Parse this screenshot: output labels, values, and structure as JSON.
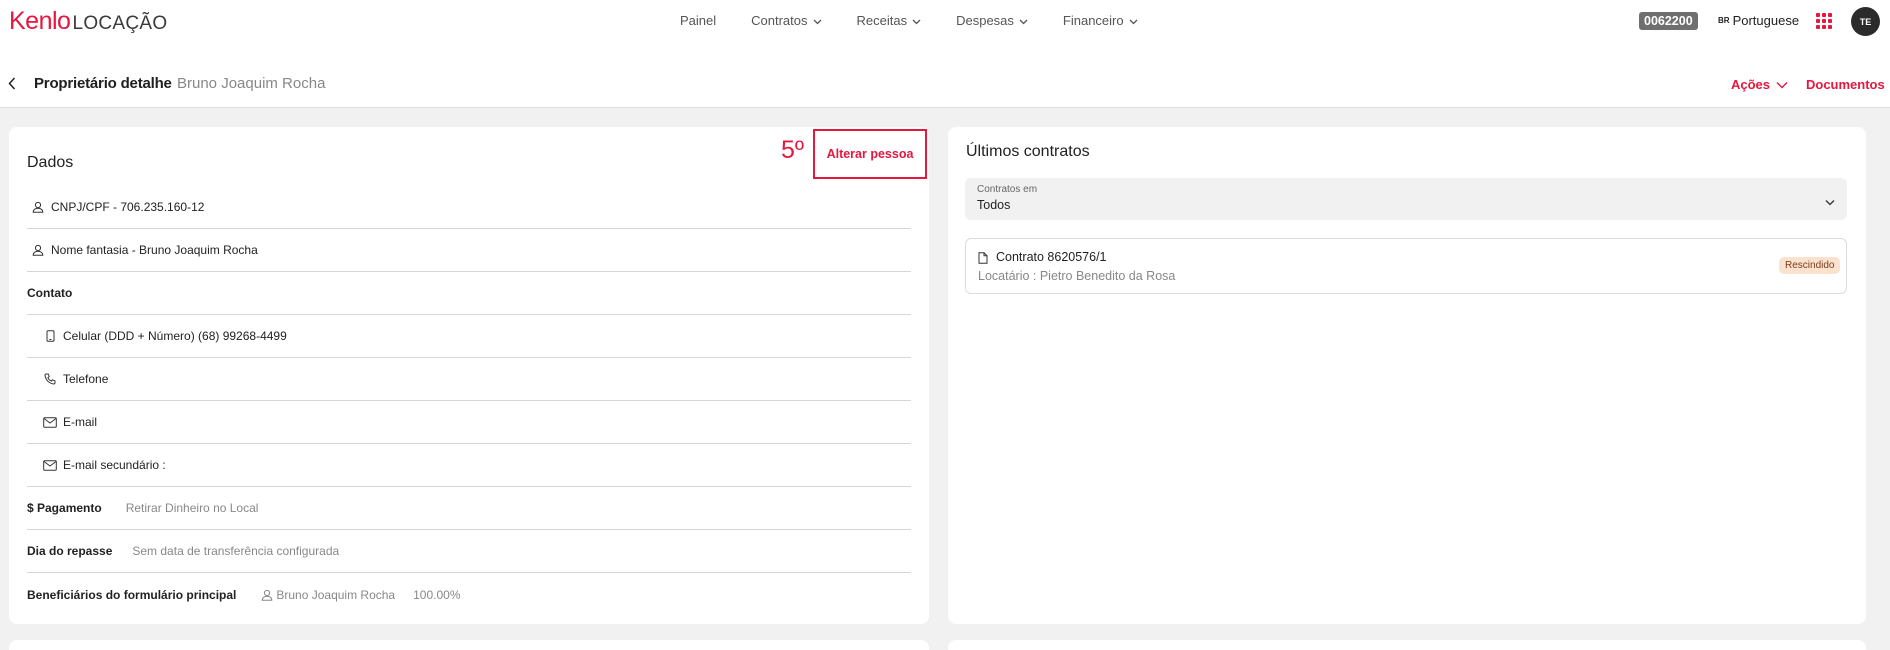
{
  "nav": {
    "logo_brand": "Kenlo",
    "logo_product": "LOCAÇÃO",
    "items": [
      {
        "label": "Painel"
      },
      {
        "label": "Contratos"
      },
      {
        "label": "Receitas"
      },
      {
        "label": "Despesas"
      },
      {
        "label": "Financeiro"
      }
    ],
    "code": "0062200",
    "lang_code": "BR",
    "lang_label": "Portuguese",
    "avatar_initials": "TE"
  },
  "header": {
    "title": "Proprietário detalhe",
    "subtitle": "Bruno Joaquim Rocha",
    "actions_label": "Ações",
    "documents_label": "Documentos"
  },
  "dados": {
    "title": "Dados",
    "annotation": "5º",
    "alterar_label": "Alterar pessoa",
    "cnpj": "CNPJ/CPF - 706.235.160-12",
    "nome_fantasia": "Nome fantasia - Bruno Joaquim Rocha",
    "contato_label": "Contato",
    "celular": "Celular (DDD + Número) (68) 99268-4499",
    "telefone": "Telefone",
    "email": "E-mail",
    "email_secundario": "E-mail secundário :",
    "pagamento_label": "$ Pagamento",
    "pagamento_value": "Retirar Dinheiro no Local",
    "repasse_label": "Dia do repasse",
    "repasse_value": "Sem data de transferência configurada",
    "beneficiarios_label": "Beneficiários do formulário principal",
    "beneficiario_name": "Bruno Joaquim Rocha",
    "beneficiario_pct": "100.00%"
  },
  "ultimos": {
    "title": "Últimos contratos",
    "filter_label": "Contratos em",
    "filter_value": "Todos",
    "contract_title": "Contrato 8620576/1",
    "contract_sub": "Locatário : Pietro Benedito da Rosa",
    "contract_status": "Rescindido"
  },
  "colors": {
    "accent": "#e5173f",
    "badge_bg": "#fbe2cf"
  }
}
